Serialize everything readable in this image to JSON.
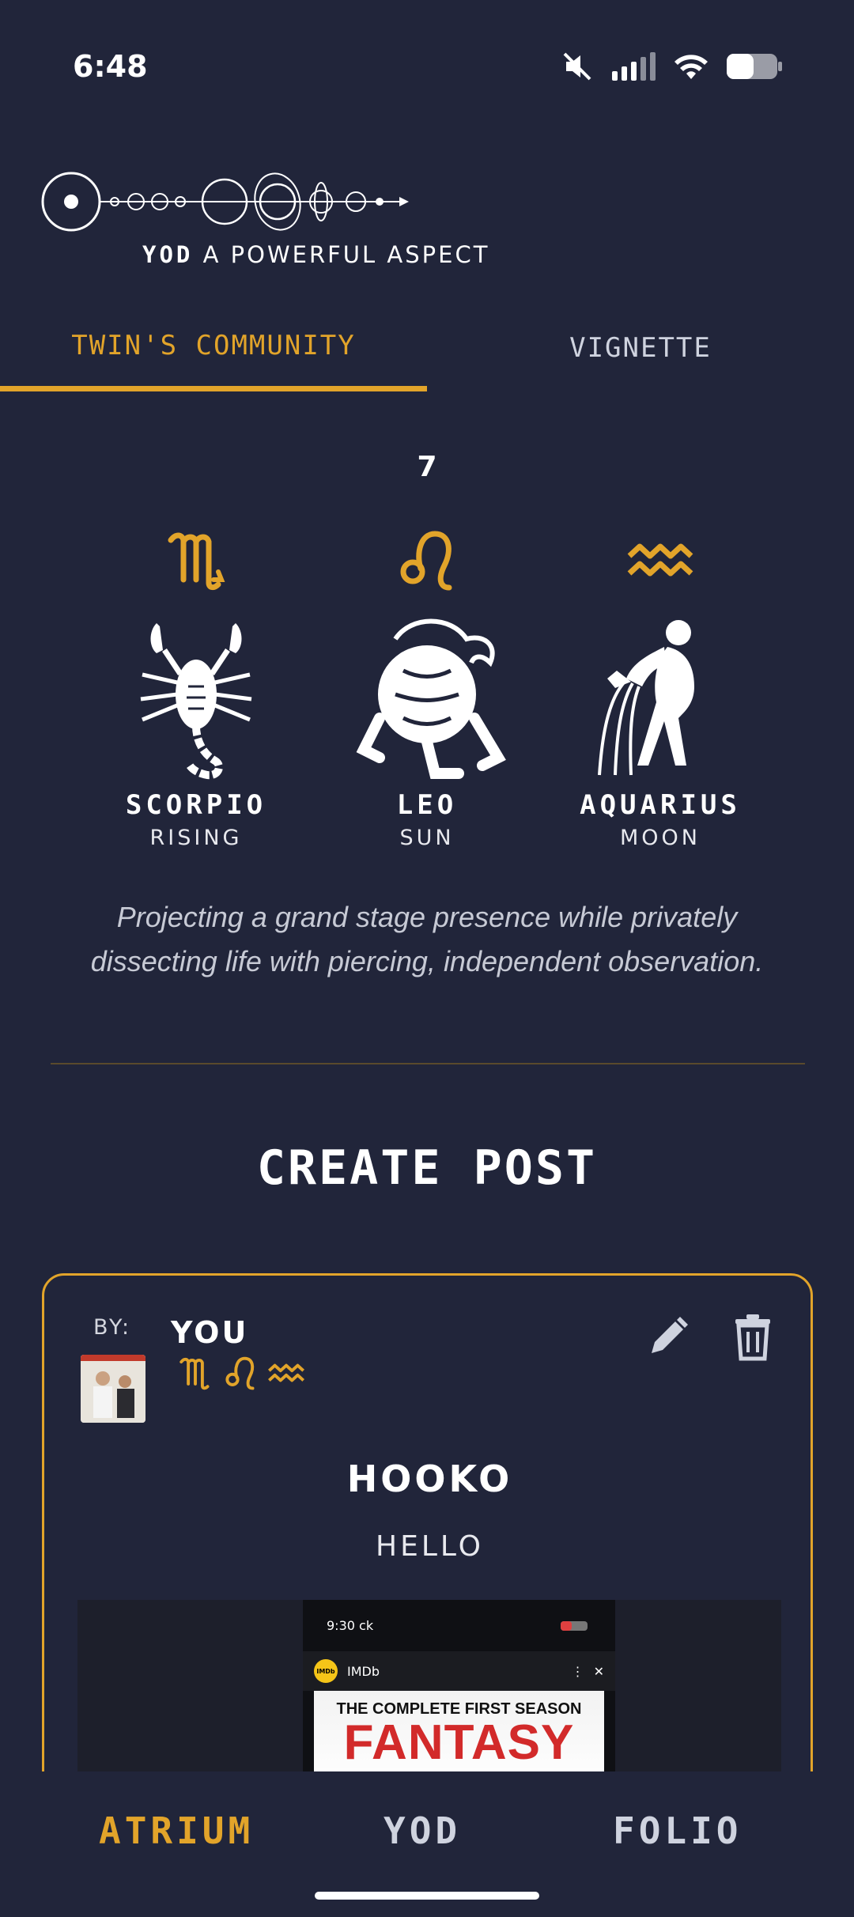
{
  "status_bar": {
    "time": "6:48",
    "icons": [
      "mute-icon",
      "signal-icon",
      "wifi-icon",
      "battery-icon"
    ]
  },
  "brand": {
    "yod": "YOD",
    "tagline": "A POWERFUL ASPECT"
  },
  "tabs": [
    {
      "label": "TWIN'S COMMUNITY",
      "active": true
    },
    {
      "label": "VIGNETTE",
      "active": false
    }
  ],
  "count": "7",
  "signs": [
    {
      "glyph": "♏",
      "name": "SCORPIO",
      "role": "RISING",
      "icon": "scorpion-icon"
    },
    {
      "glyph": "♌",
      "name": "LEO",
      "role": "SUN",
      "icon": "lion-icon"
    },
    {
      "glyph": "♒",
      "name": "AQUARIUS",
      "role": "MOON",
      "icon": "water-bearer-icon"
    }
  ],
  "description": "Projecting a grand stage presence while privately dissecting life with piercing, independent observation.",
  "create_post_title": "CREATE POST",
  "post": {
    "by_label": "BY:",
    "author": "YOU",
    "author_signs": "♏♌♒",
    "title": "HOOKO",
    "body": "HELLO",
    "screenshot": {
      "time": "9:30",
      "status_extra": "ck",
      "app_name": "IMDb",
      "badge": "IMDb",
      "poster_top": "THE COMPLETE FIRST SEASON",
      "poster_main": "FANTASY"
    }
  },
  "bottom_nav": [
    {
      "label": "ATRIUM",
      "active": true
    },
    {
      "label": "YOD",
      "active": false
    },
    {
      "label": "FOLIO",
      "active": false
    }
  ],
  "colors": {
    "background": "#21253a",
    "accent": "#e2a42a",
    "text": "#ffffff"
  }
}
